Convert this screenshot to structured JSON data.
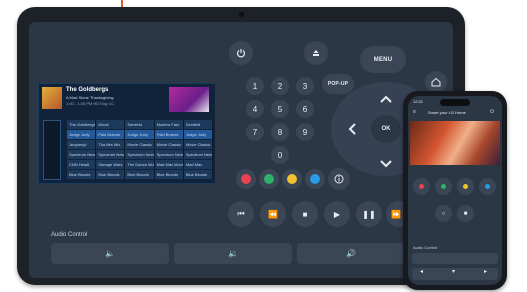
{
  "guide": {
    "show_title": "The Goldbergs",
    "episode_title": "A Mad Stone Thanksgiving",
    "meta": "1:00 - 1:30 PM  HD  Eng CC",
    "rows": [
      [
        "The Goldbergs",
        "Worst",
        "Seinfeld",
        "Modern Fam",
        "Seinfeld"
      ],
      [
        "Judge Judy",
        "Paid Brands",
        "Judge Judy",
        "Paid Brands",
        "Judge Judy"
      ],
      [
        "Jeopardy!",
        "Tha Mrs Mix",
        "Movie Classic",
        "Movie Classic",
        "Movie Classic"
      ],
      [
        "Spectrum News",
        "Spectrum News",
        "Spectrum News",
        "Spectrum News",
        "Spectrum News"
      ],
      [
        "CNN Headl",
        "Storage Wars",
        "The Dance Moms",
        "Mad Max Movie",
        "Mad Max"
      ],
      [
        "Blue Bloods",
        "Blue Bloods",
        "Blue Bloods",
        "Blue Bloods",
        "Blue Bloods"
      ]
    ]
  },
  "remote": {
    "menu_label": "MENU",
    "popup_label": "POP-UP",
    "ok_label": "OK",
    "digits": [
      "1",
      "2",
      "3",
      "4",
      "5",
      "6",
      "7",
      "8",
      "9",
      "0"
    ],
    "color_buttons": [
      "#e8434f",
      "#2fb16b",
      "#f2c12e",
      "#2b9be6"
    ]
  },
  "audio": {
    "label": "Audio Control"
  },
  "phone": {
    "time": "12:31",
    "title": "Smart your LG Home",
    "audio_label": "Audio Control"
  },
  "colors": {
    "accent": "#d9622b",
    "screen_bg": "#2c3745",
    "button_bg": "#3a4656"
  }
}
